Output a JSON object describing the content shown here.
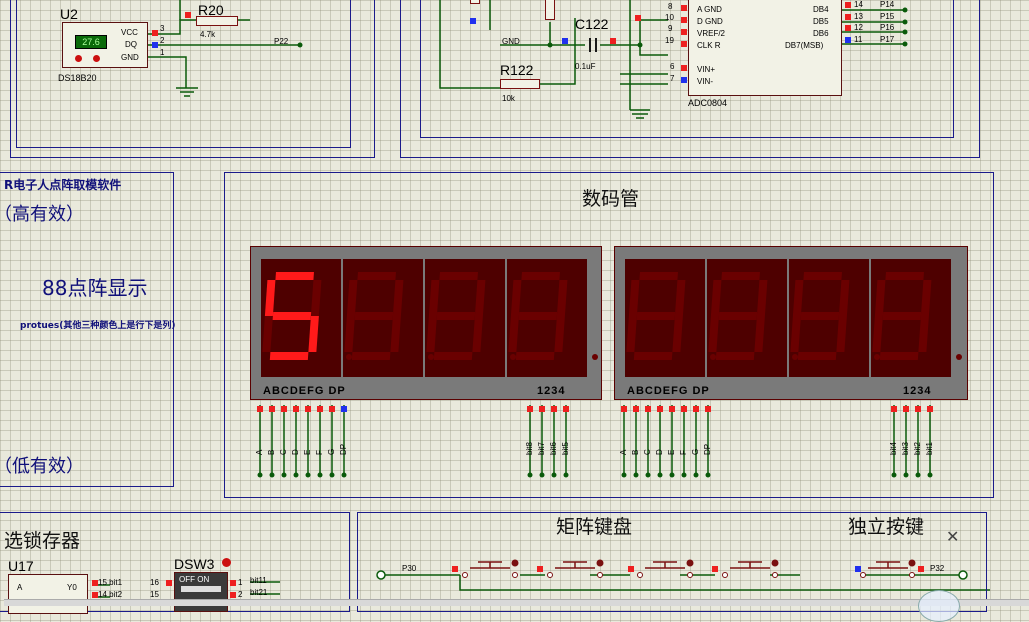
{
  "schematic": {
    "sections": {
      "display_title": "数码管",
      "matrix_keypad_title": "矩阵键盘",
      "independent_keys_title": "独立按键",
      "latch_title": "选锁存器",
      "dot_matrix_header": "R电子人点阵取模软件",
      "high_active": "（高有效）",
      "low_active": "（低有效）",
      "dot_matrix_title": "88点阵显示",
      "dot_matrix_note": "protues(其他三种颜色上是行下是列)"
    },
    "ds18b20": {
      "ref": "U2",
      "reading": "27.6",
      "part": "DS18B20",
      "pins": [
        "VCC",
        "DQ",
        "GND"
      ],
      "pin_nums": [
        "3",
        "2",
        "1"
      ]
    },
    "r20": {
      "ref": "R20",
      "value": "4.7k"
    },
    "p22_label": "P22",
    "c122": {
      "ref": "C122",
      "value": "0.1uF"
    },
    "r122": {
      "ref": "R122",
      "value": "10k"
    },
    "gnd_label": "GND",
    "adc0804": {
      "part": "ADC0804",
      "left_pins": [
        "A GND",
        "D GND",
        "VREF/2",
        "CLK R",
        "VIN+",
        "VIN-"
      ],
      "left_nums": [
        "8",
        "10",
        "9",
        "19",
        "6",
        "7"
      ],
      "right_pins": [
        "DB4",
        "DB5",
        "DB6",
        "DB7(MSB)"
      ],
      "right_nums": [
        "14",
        "13",
        "12",
        "11"
      ],
      "right_nets": [
        "P14",
        "P15",
        "P16",
        "P17"
      ]
    },
    "seg_display_1": {
      "segment_label": "ABCDEFG  DP",
      "digit_label": "1234",
      "seg_pins": [
        "A",
        "B",
        "C",
        "D",
        "E",
        "F",
        "G",
        "DP"
      ],
      "bit_pins": [
        "bit8",
        "bit7",
        "bit6",
        "bit5"
      ],
      "shown_char": "5"
    },
    "seg_display_2": {
      "segment_label": "ABCDEFG  DP",
      "digit_label": "1234",
      "seg_pins": [
        "A",
        "B",
        "C",
        "D",
        "E",
        "F",
        "G",
        "DP"
      ],
      "bit_pins": [
        "bit4",
        "bit3",
        "bit2",
        "bit1"
      ]
    },
    "keypad": {
      "net_left": "P30",
      "net_right": "P32"
    },
    "u17": {
      "ref": "U17",
      "pins": [
        "A",
        "Y0"
      ],
      "nets": [
        "15 bit1",
        "14 bit2"
      ]
    },
    "dsw3": {
      "ref": "DSW3",
      "off_on": "OFF  ON",
      "pin_nums": [
        "16",
        "15"
      ],
      "nets": [
        "1",
        "2"
      ],
      "bit_nets": [
        "bit11",
        "bit21"
      ]
    }
  },
  "colors": {
    "frame": "#1a1a8a",
    "segment_on": "#ff1a1a",
    "segment_off": "#6a0000",
    "wire": "#0a5a0a",
    "background": "#e9e9dc"
  }
}
